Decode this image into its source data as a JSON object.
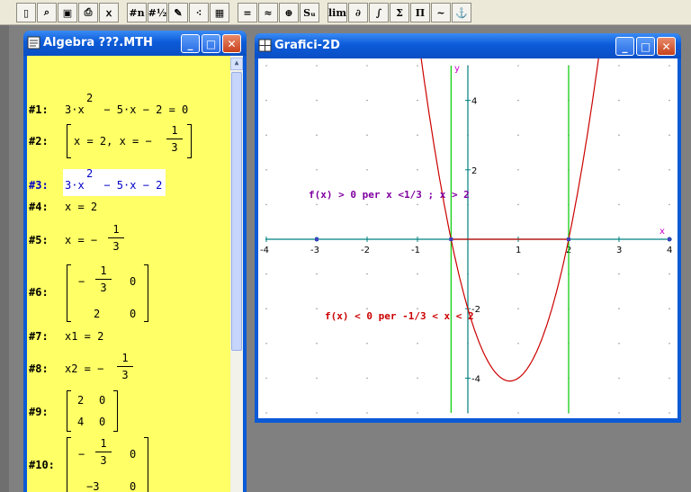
{
  "toolbar": {
    "buttons": [
      {
        "name": "new-file-icon",
        "glyph": "▯"
      },
      {
        "name": "open-file-icon",
        "glyph": "⌕"
      },
      {
        "name": "save-icon",
        "glyph": "▣"
      },
      {
        "name": "print-icon",
        "glyph": "⎙"
      },
      {
        "name": "author-expression-icon",
        "glyph": "ｘ"
      },
      {
        "name": "simplify-icon",
        "glyph": "#n"
      },
      {
        "name": "approximate-icon",
        "glyph": "#½"
      },
      {
        "name": "plot-icon",
        "glyph": "✎"
      },
      {
        "name": "2d-plot-icon",
        "glyph": "⁖"
      },
      {
        "name": "matrix-icon",
        "glyph": "▦"
      },
      {
        "name": "solve-icon",
        "glyph": "="
      },
      {
        "name": "approx-equal-icon",
        "glyph": "≈"
      },
      {
        "name": "zoom-icon",
        "glyph": "⊕"
      },
      {
        "name": "substitute-icon",
        "glyph": "Sᵤ"
      },
      {
        "name": "limit-icon",
        "glyph": "lim"
      },
      {
        "name": "derivative-icon",
        "glyph": "∂"
      },
      {
        "name": "integral-icon",
        "glyph": "∫"
      },
      {
        "name": "sum-icon",
        "glyph": "Σ"
      },
      {
        "name": "product-icon",
        "glyph": "Π"
      },
      {
        "name": "taylor-icon",
        "glyph": "~"
      },
      {
        "name": "vector-icon",
        "glyph": "⚓"
      }
    ]
  },
  "algebra_window": {
    "title": "Algebra ???.MTH",
    "lines": {
      "l1": {
        "label": "#1:",
        "expr": "3·x   − 5·x − 2 = 0",
        "sup": "2"
      },
      "l2": {
        "label": "#2:",
        "expr": "x = 2, x = −",
        "num": "1",
        "den": "3"
      },
      "l3": {
        "label": "#3:",
        "expr": "3·x   − 5·x − 2",
        "sup": "2"
      },
      "l4": {
        "label": "#4:",
        "expr": "x = 2"
      },
      "l5": {
        "label": "#5:",
        "expr": "x = −",
        "num": "1",
        "den": "3"
      },
      "l6": {
        "label": "#6:",
        "minus": "−",
        "num": "1",
        "den": "3",
        "c12": "0",
        "c21": "2",
        "c22": "0"
      },
      "l7": {
        "label": "#7:",
        "expr": "x1 = 2"
      },
      "l8": {
        "label": "#8:",
        "expr": "x2 = −",
        "num": "1",
        "den": "3"
      },
      "l9": {
        "label": "#9:",
        "c11": "2",
        "c12": "0",
        "c21": "4",
        "c22": "0"
      },
      "l10": {
        "label": "#10:",
        "minus": "−",
        "num": "1",
        "den": "3",
        "c12": "0",
        "c21": "−3",
        "c22": "0"
      }
    }
  },
  "graph_window": {
    "title": "Grafici-2D",
    "x_axis_label": "x",
    "y_axis_label": "y",
    "annotation_positive": "f(x) > 0 per x <1/3 ; x > 2",
    "annotation_negative": "f(x) < 0 per -1/3 < x < 2",
    "colors": {
      "curve": "#cc0000",
      "axes": "#008080",
      "vertical_lines": "#00cc00",
      "positive_text": "#8000a0",
      "negative_text": "#cc0000",
      "y_label": "#cc00cc"
    }
  },
  "chart_data": {
    "type": "line",
    "function": "3x^2 - 5x - 2",
    "xlim": [
      -4,
      4
    ],
    "ylim": [
      -5,
      5
    ],
    "x_ticks": [
      "-4",
      "-3",
      "-2",
      "-1",
      "1",
      "2",
      "3",
      "4"
    ],
    "y_ticks": [
      "4",
      "2",
      "-2",
      "-4"
    ],
    "vertical_lines_x": [
      -0.3333,
      2
    ],
    "roots": [
      -0.3333,
      2
    ],
    "vertex": [
      0.8333,
      -4.0833
    ]
  }
}
